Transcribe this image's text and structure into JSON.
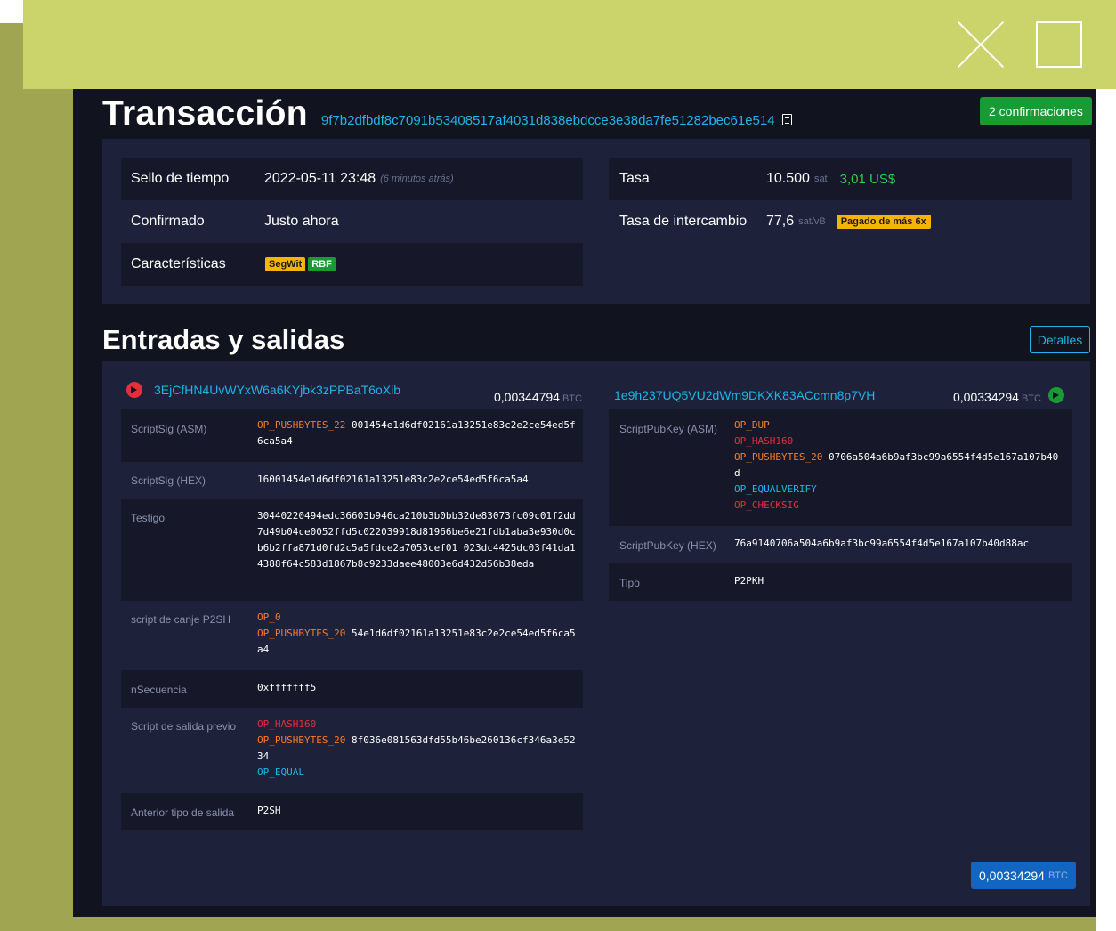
{
  "header": {
    "title": "Transacción",
    "txid": "9f7b2dfbdf8c7091b53408517af4031d838ebdcce3e38da7fe51282bec61e514",
    "confirmations": "2 confirmaciones"
  },
  "summary": {
    "timestamp": {
      "label": "Sello de tiempo",
      "value": "2022-05-11 23:48",
      "relative": "(6 minutos atrás)"
    },
    "confirmed": {
      "label": "Confirmado",
      "value": "Justo ahora"
    },
    "features": {
      "label": "Características",
      "tags": [
        "SegWit",
        "RBF"
      ]
    },
    "fee": {
      "label": "Tasa",
      "value": "10.500",
      "unit": "sat",
      "usd": "3,01 US$"
    },
    "fee_rate": {
      "label": "Tasa de intercambio",
      "value": "77,6",
      "unit": "sat/vB",
      "overpaid": "Pagado de más 6x"
    }
  },
  "io": {
    "section_title": "Entradas y salidas",
    "details_label": "Detalles",
    "input": {
      "address": "3EjCfHN4UvWYxW6a6KYjbk3zPPBaT6oXib",
      "amount": "0,00344794",
      "unit": "BTC",
      "rows": {
        "scriptsig_asm": {
          "label": "ScriptSig (ASM)",
          "op": "OP_PUSHBYTES_22",
          "data": "001454e1d6df02161a13251e83c2e2ce54ed5f6ca5a4"
        },
        "scriptsig_hex": {
          "label": "ScriptSig (HEX)",
          "value": "16001454e1d6df02161a13251e83c2e2ce54ed5f6ca5a4"
        },
        "witness": {
          "label": "Testigo",
          "value": "30440220494edc36603b946ca210b3b0bb32de83073fc09c01f2dd7d49b04ce0052ffd5c022039918d81966be6e21fdb1aba3e930d0cb6b2ffa871d0fd2c5a5fdce2a7053cef01 023dc4425dc03f41da14388f64c583d1867b8c9233daee48003e6d432d56b38eda"
        },
        "p2sh_redeem": {
          "label": "script de canje P2SH",
          "op0": "OP_0",
          "op1": "OP_PUSHBYTES_20",
          "data": "54e1d6df02161a13251e83c2e2ce54ed5f6ca5a4"
        },
        "nsequence": {
          "label": "nSecuencia",
          "value": "0xfffffff5"
        },
        "prev_script": {
          "label": "Script de salida previo",
          "op0": "OP_HASH160",
          "op1": "OP_PUSHBYTES_20",
          "data": "8f036e081563dfd55b46be260136cf346a3e5234",
          "op2": "OP_EQUAL"
        },
        "prev_type": {
          "label": "Anterior tipo de salida",
          "value": "P2SH"
        }
      }
    },
    "output": {
      "address": "1e9h237UQ5VU2dWm9DKXK83ACcmn8p7VH",
      "amount": "0,00334294",
      "unit": "BTC",
      "rows": {
        "spk_asm": {
          "label": "ScriptPubKey (ASM)",
          "op0": "OP_DUP",
          "op1": "OP_HASH160",
          "op2": "OP_PUSHBYTES_20",
          "data": "0706a504a6b9af3bc99a6554f4d5e167a107b40d",
          "op3": "OP_EQUALVERIFY",
          "op4": "OP_CHECKSIG"
        },
        "spk_hex": {
          "label": "ScriptPubKey (HEX)",
          "value": "76a9140706a504a6b9af3bc99a6554f4d5e167a107b40d88ac"
        },
        "type": {
          "label": "Tipo",
          "value": "P2PKH"
        }
      }
    },
    "total": {
      "amount": "0,00334294",
      "unit": "BTC"
    }
  },
  "colors": {
    "banner": "#cbd36b",
    "background": "#11131f",
    "panel": "#1d2139",
    "accent_blue": "#20b5e6",
    "green": "#1a9a35",
    "red": "#e52d3e",
    "orange": "#f47c2a",
    "yellow": "#f5b400"
  },
  "icons": {
    "window_close": "close-icon",
    "window_maximize": "maximize-icon",
    "copy": "copy-icon",
    "input_arrow": "arrow-circle-right-red-icon",
    "output_arrow": "arrow-circle-right-green-icon"
  }
}
